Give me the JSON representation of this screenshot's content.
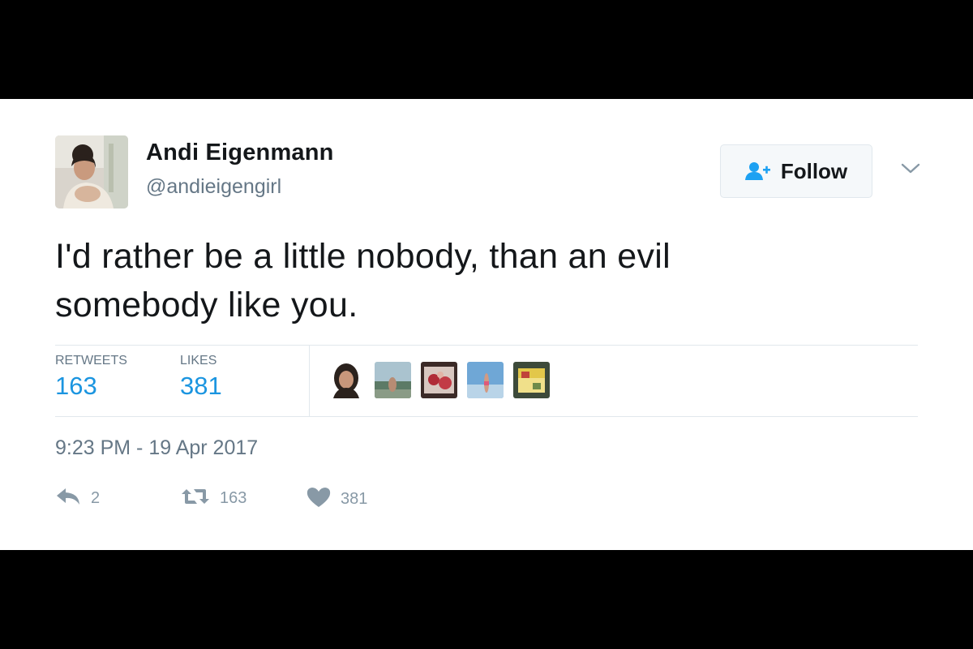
{
  "tweet": {
    "author": {
      "display_name": "Andi Eigenmann",
      "handle": "@andieigengirl"
    },
    "follow_button": {
      "label": "Follow",
      "icon": "add-user-icon"
    },
    "menu_icon": "chevron-down-icon",
    "text_lines": [
      "I'd rather be a little nobody, than an evil",
      "somebody like you."
    ],
    "stats": {
      "retweets_label": "RETWEETS",
      "retweets_value": "163",
      "likes_label": "LIKES",
      "likes_value": "381"
    },
    "liker_avatars": [
      "liker-avatar-1",
      "liker-avatar-2",
      "liker-avatar-3",
      "liker-avatar-4",
      "liker-avatar-5"
    ],
    "timestamp": "9:23 PM - 19 Apr 2017",
    "actions": {
      "reply_count": "2",
      "retweet_count": "163",
      "like_count": "381"
    }
  },
  "colors": {
    "background_frame": "#000000",
    "card": "#ffffff",
    "text_primary": "#14171a",
    "text_secondary": "#657786",
    "accent_blue": "#1b95e0",
    "follow_icon_blue": "#1da1f2",
    "action_gray": "#8899a6",
    "divider": "#e1e8ed"
  }
}
